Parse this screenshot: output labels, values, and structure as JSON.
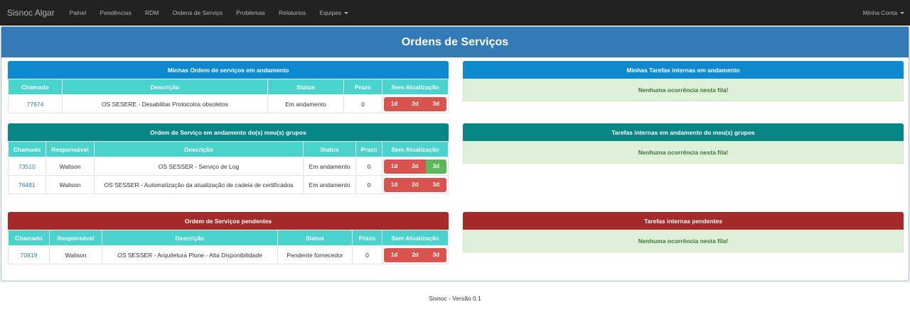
{
  "navbar": {
    "brand": "Sisnoc Algar",
    "items": [
      "Painel",
      "Pendências",
      "RDM",
      "Ordens de Serviço",
      "Problemas",
      "Relatorios",
      "Equipes"
    ],
    "account": "Minha Conta"
  },
  "page": {
    "title": "Ordens de Serviços"
  },
  "colors": {
    "danger": "#d9534f",
    "success": "#5cb85c"
  },
  "panels": {
    "my_os": {
      "title": "Minhas Ordem de serviços em andamento",
      "headers": [
        "Chamado",
        "Descrição",
        "Status",
        "Prazo",
        "Sem Atualização"
      ],
      "rows": [
        {
          "chamado": "77674",
          "descricao": "OS SESERE - Desabilitar Protocolos obsoletos",
          "status": "Em andamento",
          "prazo": "0",
          "badges": [
            {
              "label": "1d",
              "state": "danger"
            },
            {
              "label": "2d",
              "state": "danger"
            },
            {
              "label": "3d",
              "state": "danger"
            }
          ]
        }
      ]
    },
    "group_os": {
      "title": "Ordem de Serviço em andamento do(s) meu(s) grupos",
      "headers": [
        "Chamado",
        "Responsável",
        "Descrição",
        "Status",
        "Prazo",
        "Sem Atualização"
      ],
      "rows": [
        {
          "chamado": "73510",
          "responsavel": "Walison",
          "descricao": "OS SESSER - Serviço de Log",
          "status": "Em andamento",
          "prazo": "0",
          "badges": [
            {
              "label": "1d",
              "state": "danger"
            },
            {
              "label": "2d",
              "state": "danger"
            },
            {
              "label": "3d",
              "state": "success"
            }
          ]
        },
        {
          "chamado": "76481",
          "responsavel": "Walison",
          "descricao": "OS SESSER - Automatização da atualização de cadeia de certificados",
          "status": "Em andamento",
          "prazo": "0",
          "badges": [
            {
              "label": "1d",
              "state": "danger"
            },
            {
              "label": "2d",
              "state": "danger"
            },
            {
              "label": "3d",
              "state": "danger"
            }
          ]
        }
      ]
    },
    "pending_os": {
      "title": "Ordem de Serviços pendentes",
      "headers": [
        "Chamado",
        "Responsável",
        "Descrição",
        "Status",
        "Prazo",
        "Sem Atualização"
      ],
      "rows": [
        {
          "chamado": "70819",
          "responsavel": "Walison",
          "descricao": "OS SESSER - Arquitetura Plone - Alta Disponibilidade",
          "status": "Pendente fornecedor",
          "prazo": "0",
          "badges": [
            {
              "label": "1d",
              "state": "danger"
            },
            {
              "label": "2d",
              "state": "danger"
            },
            {
              "label": "3d",
              "state": "danger"
            }
          ]
        }
      ]
    },
    "my_tasks": {
      "title": "Minhas Tarefas internas em andamento",
      "empty": "Nenhuma ocorrência nesta fila!"
    },
    "group_tasks": {
      "title": "Tarefas internas em andamento do meu(s) grupos",
      "empty": "Nenhuma ocorrência nesta fila!"
    },
    "pending_tasks": {
      "title": "Tarefas internas pendentes",
      "empty": "Nenhuma ocorrência nesta fila!"
    }
  },
  "footer": "Sisnoc - Versão 0.1"
}
